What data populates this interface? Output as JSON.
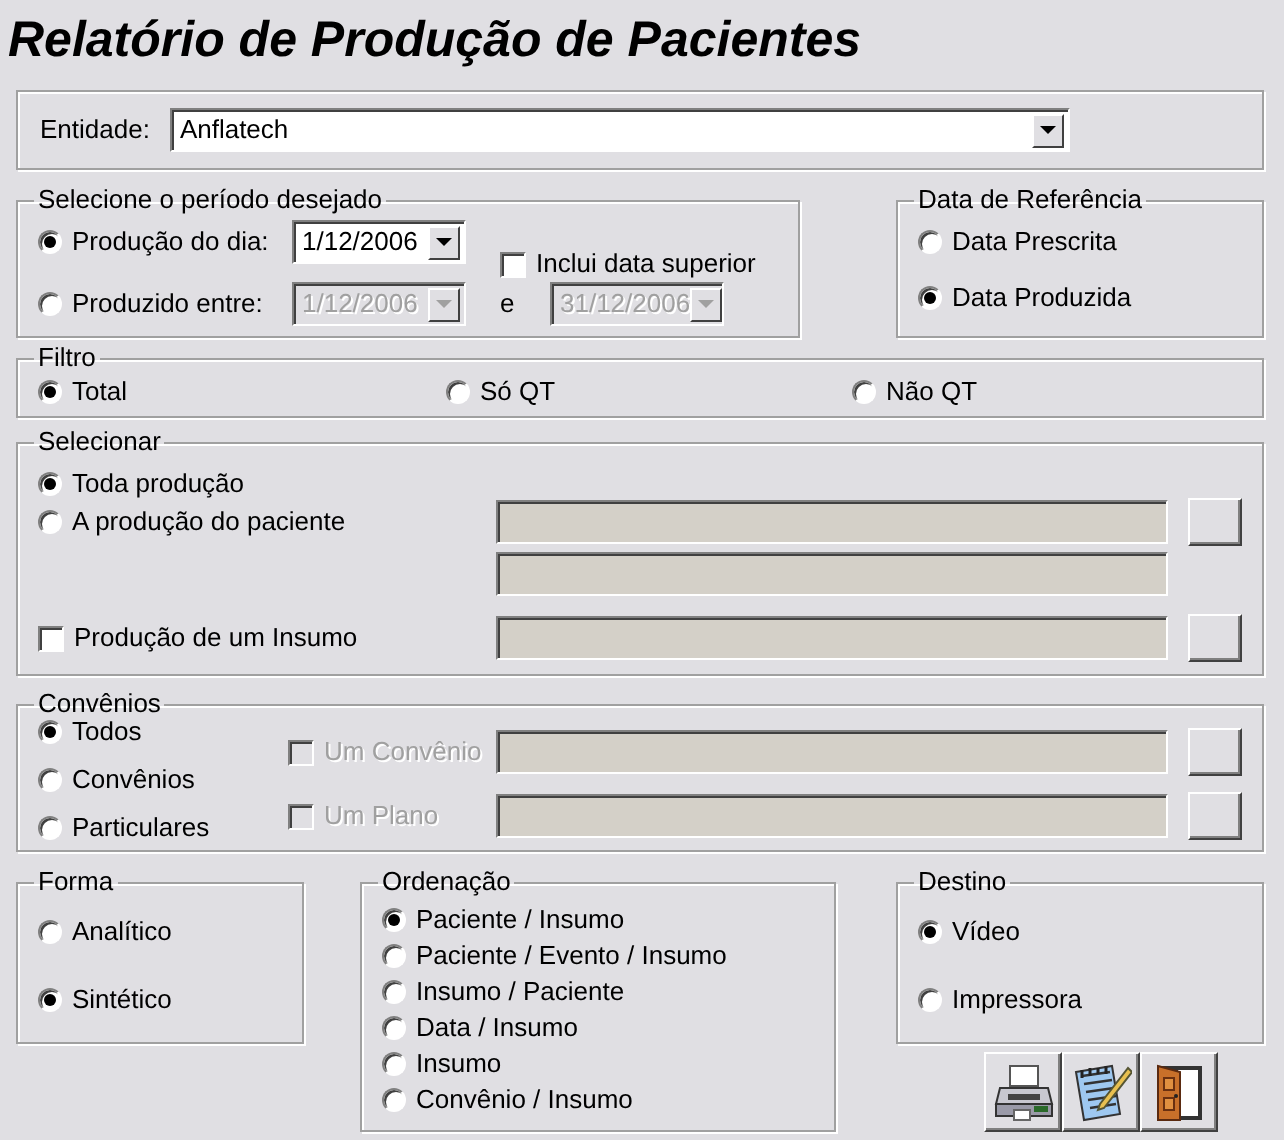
{
  "window": {
    "title": "Relatório de Produção de Pacientes"
  },
  "entidade": {
    "label": "Entidade:",
    "value": "Anflatech"
  },
  "periodo": {
    "legend": "Selecione o período desejado",
    "options": [
      {
        "label": "Produção do dia:",
        "selected": true
      },
      {
        "label": "Produzido entre:",
        "selected": false
      }
    ],
    "date_day": {
      "value": "1/12/2006",
      "disabled": false
    },
    "date_from": {
      "value": "1/12/2006",
      "disabled": true
    },
    "separator": "e",
    "date_to": {
      "value": "31/12/2006",
      "disabled": true
    },
    "include_upper": {
      "label": "Inclui data superior",
      "checked": false,
      "disabled": false
    }
  },
  "data_referencia": {
    "legend": "Data de Referência",
    "options": [
      {
        "label": "Data Prescrita",
        "selected": false
      },
      {
        "label": "Data Produzida",
        "selected": true
      }
    ]
  },
  "filtro": {
    "legend": "Filtro",
    "options": [
      {
        "label": "Total",
        "selected": true
      },
      {
        "label": "Só QT",
        "selected": false
      },
      {
        "label": "Não QT",
        "selected": false
      }
    ]
  },
  "selecionar": {
    "legend": "Selecionar",
    "options": [
      {
        "label": "Toda produção",
        "selected": true
      },
      {
        "label": "A produção do paciente",
        "selected": false
      }
    ],
    "insumo": {
      "label": "Produção de um Insumo",
      "checked": false,
      "disabled": false
    }
  },
  "convenios": {
    "legend": "Convênios",
    "options": [
      {
        "label": "Todos",
        "selected": true
      },
      {
        "label": "Convênios",
        "selected": false
      },
      {
        "label": "Particulares",
        "selected": false
      }
    ],
    "filters": [
      {
        "label": "Um Convênio",
        "checked": false,
        "disabled": true
      },
      {
        "label": "Um Plano",
        "checked": false,
        "disabled": true
      }
    ]
  },
  "forma": {
    "legend": "Forma",
    "options": [
      {
        "label": "Analítico",
        "selected": false
      },
      {
        "label": "Sintético",
        "selected": true
      }
    ]
  },
  "ordenacao": {
    "legend": "Ordenação",
    "options": [
      {
        "label": "Paciente / Insumo",
        "selected": true
      },
      {
        "label": "Paciente / Evento / Insumo",
        "selected": false
      },
      {
        "label": "Insumo / Paciente",
        "selected": false
      },
      {
        "label": "Data / Insumo",
        "selected": false
      },
      {
        "label": "Insumo",
        "selected": false
      },
      {
        "label": "Convênio / Insumo",
        "selected": false
      }
    ]
  },
  "destino": {
    "legend": "Destino",
    "options": [
      {
        "label": "Vídeo",
        "selected": true
      },
      {
        "label": "Impressora",
        "selected": false
      }
    ]
  },
  "actions": [
    {
      "kind": "print"
    },
    {
      "kind": "edit"
    },
    {
      "kind": "exit"
    }
  ]
}
